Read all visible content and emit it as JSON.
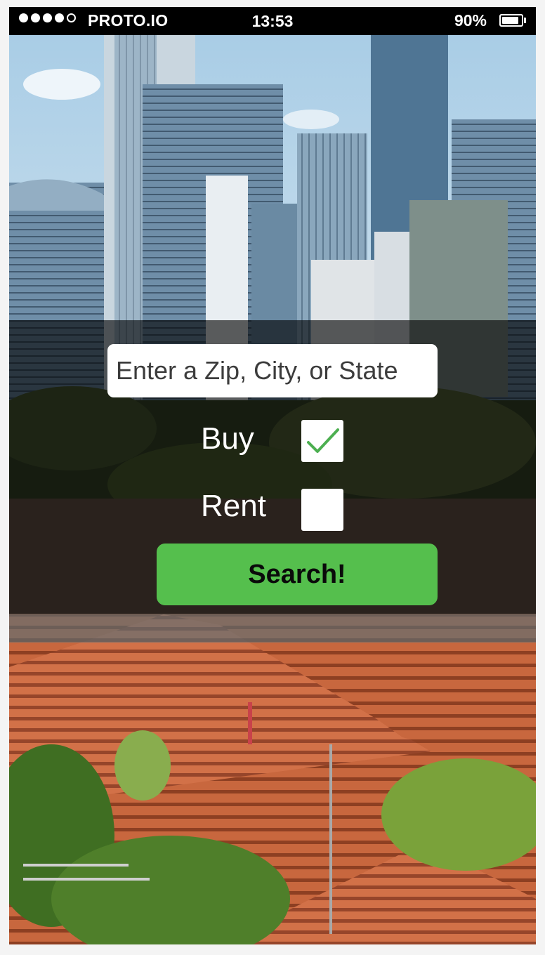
{
  "status_bar": {
    "signal_dots_filled": 4,
    "signal_dots_total": 5,
    "carrier": "PROTO.IO",
    "time": "13:53",
    "battery_percent_label": "90%",
    "battery_level": 0.9
  },
  "search": {
    "placeholder": "Enter a Zip, City, or State",
    "value": ""
  },
  "options": {
    "buy": {
      "label": "Buy",
      "checked": true
    },
    "rent": {
      "label": "Rent",
      "checked": false
    }
  },
  "search_button": {
    "label": "Search!"
  },
  "colors": {
    "accent_green": "#55bf4d",
    "check_green": "#4caf50",
    "overlay": "#000000"
  },
  "icons": {
    "battery": "battery-icon",
    "check": "checkmark-icon",
    "signal": "signal-dots-icon"
  }
}
